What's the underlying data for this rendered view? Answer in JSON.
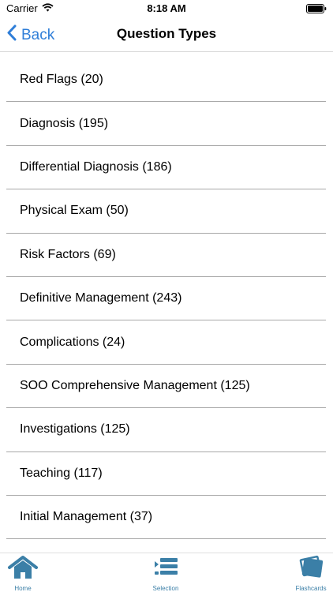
{
  "status": {
    "carrier": "Carrier",
    "time": "8:18 AM"
  },
  "nav": {
    "back_label": "Back",
    "title": "Question Types"
  },
  "items": [
    "Red Flags (20)",
    "Diagnosis (195)",
    "Differential Diagnosis (186)",
    "Physical Exam (50)",
    "Risk Factors (69)",
    "Definitive Management (243)",
    "Complications (24)",
    "SOO Comprehensive Management (125)",
    "Investigations (125)",
    "Teaching (117)",
    "Initial Management (37)"
  ],
  "tabs": [
    {
      "label": "Home",
      "icon": "home-icon"
    },
    {
      "label": "Selection",
      "icon": "list-selection-icon"
    },
    {
      "label": "Flashcards",
      "icon": "flashcards-icon"
    }
  ],
  "colors": {
    "accent": "#2f7ed8",
    "tab": "#3b7fa7"
  }
}
